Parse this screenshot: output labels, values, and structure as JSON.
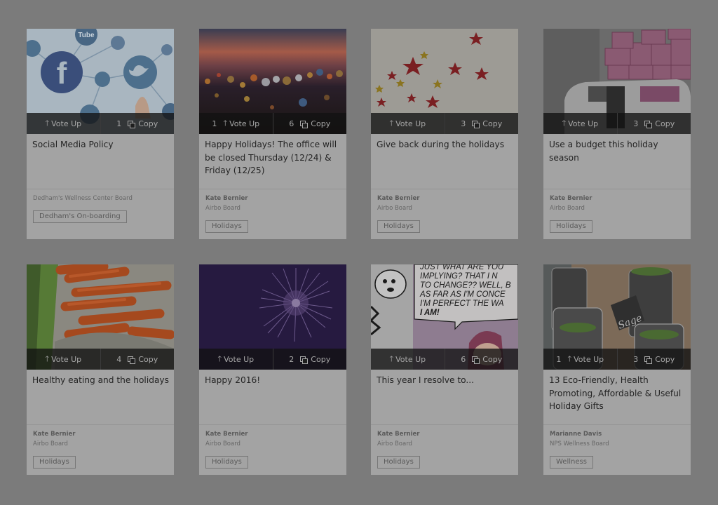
{
  "cards": [
    {
      "title": "Social Media Policy",
      "author": "",
      "board": "Dedham's Wellness Center Board",
      "tag": "Dedham's On-boarding",
      "vote_count": "",
      "vote_label": "Vote Up",
      "copy_count": "1",
      "copy_label": "Copy",
      "image": "social-media-icons"
    },
    {
      "title": "Happy Holidays! The office will be closed Thursday (12/24) & Friday (12/25)",
      "author": "Kate Bernier",
      "board": "Airbo Board",
      "tag": "Holidays",
      "vote_count": "1",
      "vote_label": "Vote Up",
      "copy_count": "6",
      "copy_label": "Copy",
      "image": "bokeh-sunset"
    },
    {
      "title": "Give back during the holidays",
      "author": "Kate Bernier",
      "board": "Airbo Board",
      "tag": "Holidays",
      "vote_count": "",
      "vote_label": "Vote Up",
      "copy_count": "3",
      "copy_label": "Copy",
      "image": "red-stars"
    },
    {
      "title": "Use a budget this holiday season",
      "author": "Kate Bernier",
      "board": "Airbo Board",
      "tag": "Holidays",
      "vote_count": "",
      "vote_label": "Vote Up",
      "copy_count": "3",
      "copy_label": "Copy",
      "image": "car-with-gifts"
    },
    {
      "title": "Healthy eating and the holidays",
      "author": "Kate Bernier",
      "board": "Airbo Board",
      "tag": "Holidays",
      "vote_count": "",
      "vote_label": "Vote Up",
      "copy_count": "4",
      "copy_label": "Copy",
      "image": "carrots"
    },
    {
      "title": "Happy 2016!",
      "author": "Kate Bernier",
      "board": "Airbo Board",
      "tag": "Holidays",
      "vote_count": "",
      "vote_label": "Vote Up",
      "copy_count": "2",
      "copy_label": "Copy",
      "image": "fireworks"
    },
    {
      "title": "This year I resolve to...",
      "author": "Kate Bernier",
      "board": "Airbo Board",
      "tag": "Holidays",
      "vote_count": "",
      "vote_label": "Vote Up",
      "copy_count": "6",
      "copy_label": "Copy",
      "image": "comic-strip"
    },
    {
      "title": "13 Eco-Friendly, Health Promoting, Affordable & Useful Holiday Gifts",
      "author": "Marianne Davis",
      "board": "NPS Wellness Board",
      "tag": "Wellness",
      "vote_count": "1",
      "vote_label": "Vote Up",
      "copy_count": "3",
      "copy_label": "Copy",
      "image": "herb-jars"
    }
  ],
  "comic_text": [
    "JUST WHAT ARE YOU",
    "IMPLYING? THAT I N",
    "TO CHANGE?? WELL, B",
    "AS FAR AS I'M CONCE",
    "I'M PERFECT THE WA",
    "I AM!"
  ],
  "jar_label": "Sage",
  "social_logo_text": "Tube"
}
